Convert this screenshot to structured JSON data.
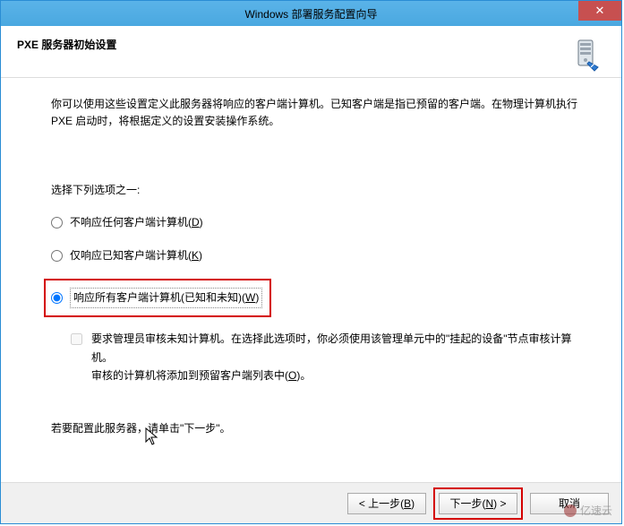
{
  "window": {
    "title": "Windows 部署服务配置向导",
    "close_glyph": "✕"
  },
  "header": {
    "page_title": "PXE 服务器初始设置"
  },
  "content": {
    "intro": "你可以使用这些设置定义此服务器将响应的客户端计算机。已知客户端是指已预留的客户端。在物理计算机执行 PXE 启动时，将根据定义的设置安装操作系统。",
    "prompt": "选择下列选项之一:",
    "radios": {
      "opt1": {
        "label": "不响应任何客户端计算机(",
        "accel": "D",
        "tail": ")"
      },
      "opt2": {
        "label": "仅响应已知客户端计算机(",
        "accel": "K",
        "tail": ")"
      },
      "opt3": {
        "label": "响应所有客户端计算机(已知和未知)(",
        "accel": "W",
        "tail": ")"
      }
    },
    "checkbox": {
      "label_line1": "要求管理员审核未知计算机。在选择此选项时，你必须使用该管理单元中的\"挂起的设备\"节点审核计算机。",
      "label_line2_pre": "审核的计算机将添加到预留客户端列表中(",
      "accel": "O",
      "tail": ")。"
    },
    "hint": "若要配置此服务器，请单击\"下一步\"。"
  },
  "buttons": {
    "back_pre": "< 上一步(",
    "back_accel": "B",
    "back_tail": ")",
    "next_pre": "下一步(",
    "next_accel": "N",
    "next_tail": ") >",
    "cancel": "取消"
  },
  "watermark": {
    "text": "亿速云"
  }
}
